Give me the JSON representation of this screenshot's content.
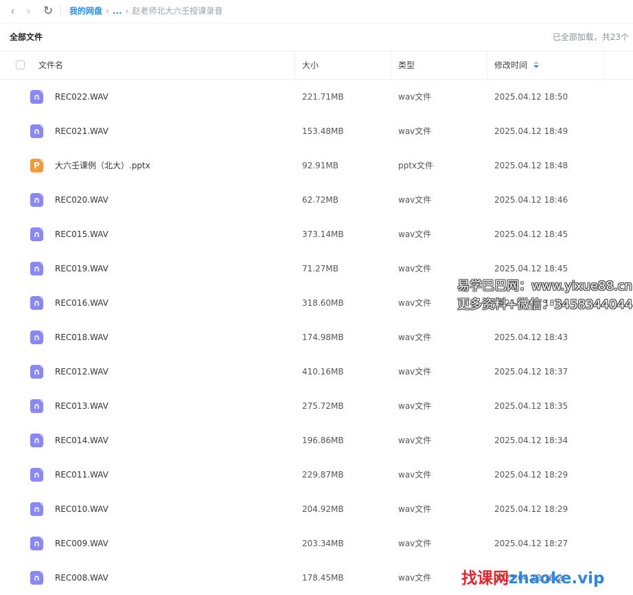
{
  "nav": {
    "back_icon": "‹",
    "forward_icon": "›",
    "refresh_icon": "↻"
  },
  "breadcrumb": {
    "root": "我的网盘",
    "ellipsis": "...",
    "current": "赵老师北大六壬授课录音",
    "separator": "›"
  },
  "header": {
    "title": "全部文件",
    "count_text": "已全部加载，共23个"
  },
  "columns": {
    "name": "文件名",
    "size": "大小",
    "type": "类型",
    "modified": "修改时间"
  },
  "colors": {
    "accent": "#2a8df0",
    "audio_icon": "#8a88f4",
    "pptx_icon": "#f59a3c"
  },
  "files": [
    {
      "name": "REC022.WAV",
      "size": "221.71MB",
      "type": "wav文件",
      "time": "2025.04.12 18:50",
      "icon": "audio-file-icon",
      "glyph": "∩"
    },
    {
      "name": "REC021.WAV",
      "size": "153.48MB",
      "type": "wav文件",
      "time": "2025.04.12 18:49",
      "icon": "audio-file-icon",
      "glyph": "∩"
    },
    {
      "name": "大六壬课例（北大）.pptx",
      "size": "92.91MB",
      "type": "pptx文件",
      "time": "2025.04.12 18:48",
      "icon": "pptx-file-icon",
      "glyph": "P"
    },
    {
      "name": "REC020.WAV",
      "size": "62.72MB",
      "type": "wav文件",
      "time": "2025.04.12 18:46",
      "icon": "audio-file-icon",
      "glyph": "∩"
    },
    {
      "name": "REC015.WAV",
      "size": "373.14MB",
      "type": "wav文件",
      "time": "2025.04.12 18:45",
      "icon": "audio-file-icon",
      "glyph": "∩"
    },
    {
      "name": "REC019.WAV",
      "size": "71.27MB",
      "type": "wav文件",
      "time": "2025.04.12 18:45",
      "icon": "audio-file-icon",
      "glyph": "∩"
    },
    {
      "name": "REC016.WAV",
      "size": "318.60MB",
      "type": "wav文件",
      "time": "2025.04.12 18:44",
      "icon": "audio-file-icon",
      "glyph": "∩"
    },
    {
      "name": "REC018.WAV",
      "size": "174.98MB",
      "type": "wav文件",
      "time": "2025.04.12 18:43",
      "icon": "audio-file-icon",
      "glyph": "∩"
    },
    {
      "name": "REC012.WAV",
      "size": "410.16MB",
      "type": "wav文件",
      "time": "2025.04.12 18:37",
      "icon": "audio-file-icon",
      "glyph": "∩"
    },
    {
      "name": "REC013.WAV",
      "size": "275.72MB",
      "type": "wav文件",
      "time": "2025.04.12 18:35",
      "icon": "audio-file-icon",
      "glyph": "∩"
    },
    {
      "name": "REC014.WAV",
      "size": "196.86MB",
      "type": "wav文件",
      "time": "2025.04.12 18:34",
      "icon": "audio-file-icon",
      "glyph": "∩"
    },
    {
      "name": "REC011.WAV",
      "size": "229.87MB",
      "type": "wav文件",
      "time": "2025.04.12 18:29",
      "icon": "audio-file-icon",
      "glyph": "∩"
    },
    {
      "name": "REC010.WAV",
      "size": "204.92MB",
      "type": "wav文件",
      "time": "2025.04.12 18:29",
      "icon": "audio-file-icon",
      "glyph": "∩"
    },
    {
      "name": "REC009.WAV",
      "size": "203.34MB",
      "type": "wav文件",
      "time": "2025.04.12 18:27",
      "icon": "audio-file-icon",
      "glyph": "∩"
    },
    {
      "name": "REC008.WAV",
      "size": "178.45MB",
      "type": "wav文件",
      "time": "2025.04.12 18:2",
      "icon": "audio-file-icon",
      "glyph": "∩"
    }
  ],
  "watermarks": {
    "line1": "易学巴巴网：www.yixue88.cn",
    "line2": "更多资料+微信：3458344044",
    "bottom_cn": "找课网",
    "bottom_en": "zhaoke.vip"
  }
}
